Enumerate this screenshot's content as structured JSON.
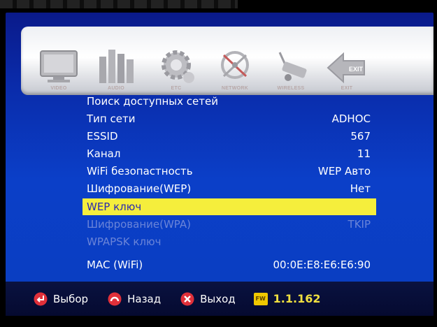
{
  "menu_icons": [
    {
      "name": "video-icon",
      "label": "VIDEO"
    },
    {
      "name": "audio-icon",
      "label": "AUDIO"
    },
    {
      "name": "etc-icon",
      "label": "ETC"
    },
    {
      "name": "network-icon",
      "label": "NETWORK"
    },
    {
      "name": "wireless-icon",
      "label": "WIRELESS"
    },
    {
      "name": "exit-icon",
      "label": "EXIT"
    }
  ],
  "exit_badge": "EXIT",
  "settings": [
    {
      "label": "Поиск доступных сетей",
      "value": ""
    },
    {
      "label": "Тип сети",
      "value": "ADHOC"
    },
    {
      "label": "ESSID",
      "value": "567"
    },
    {
      "label": "Канал",
      "value": "11"
    },
    {
      "label": "WiFi безопастность",
      "value": "WEP Авто"
    },
    {
      "label": "Шифрование(WEP)",
      "value": "Нет"
    },
    {
      "label": "WEP ключ",
      "value": ""
    },
    {
      "label": "Шифрование(WPA)",
      "value": "TKIP"
    },
    {
      "label": "WPAPSK ключ",
      "value": ""
    },
    {
      "label": "MAC (WiFi)",
      "value": "00:0E:E8:E6:E6:90"
    }
  ],
  "footer": {
    "select_label": "Выбор",
    "back_label": "Назад",
    "exit_label": "Выход",
    "fw_badge": "FW",
    "fw_version": "1.1.162"
  },
  "colors": {
    "highlight": "#f5ee3c",
    "background": "#0b3fc8",
    "footer": "#050a30",
    "select_icon": "#e0303a",
    "back_icon": "#e0303a",
    "exit_icon": "#e0303a"
  }
}
